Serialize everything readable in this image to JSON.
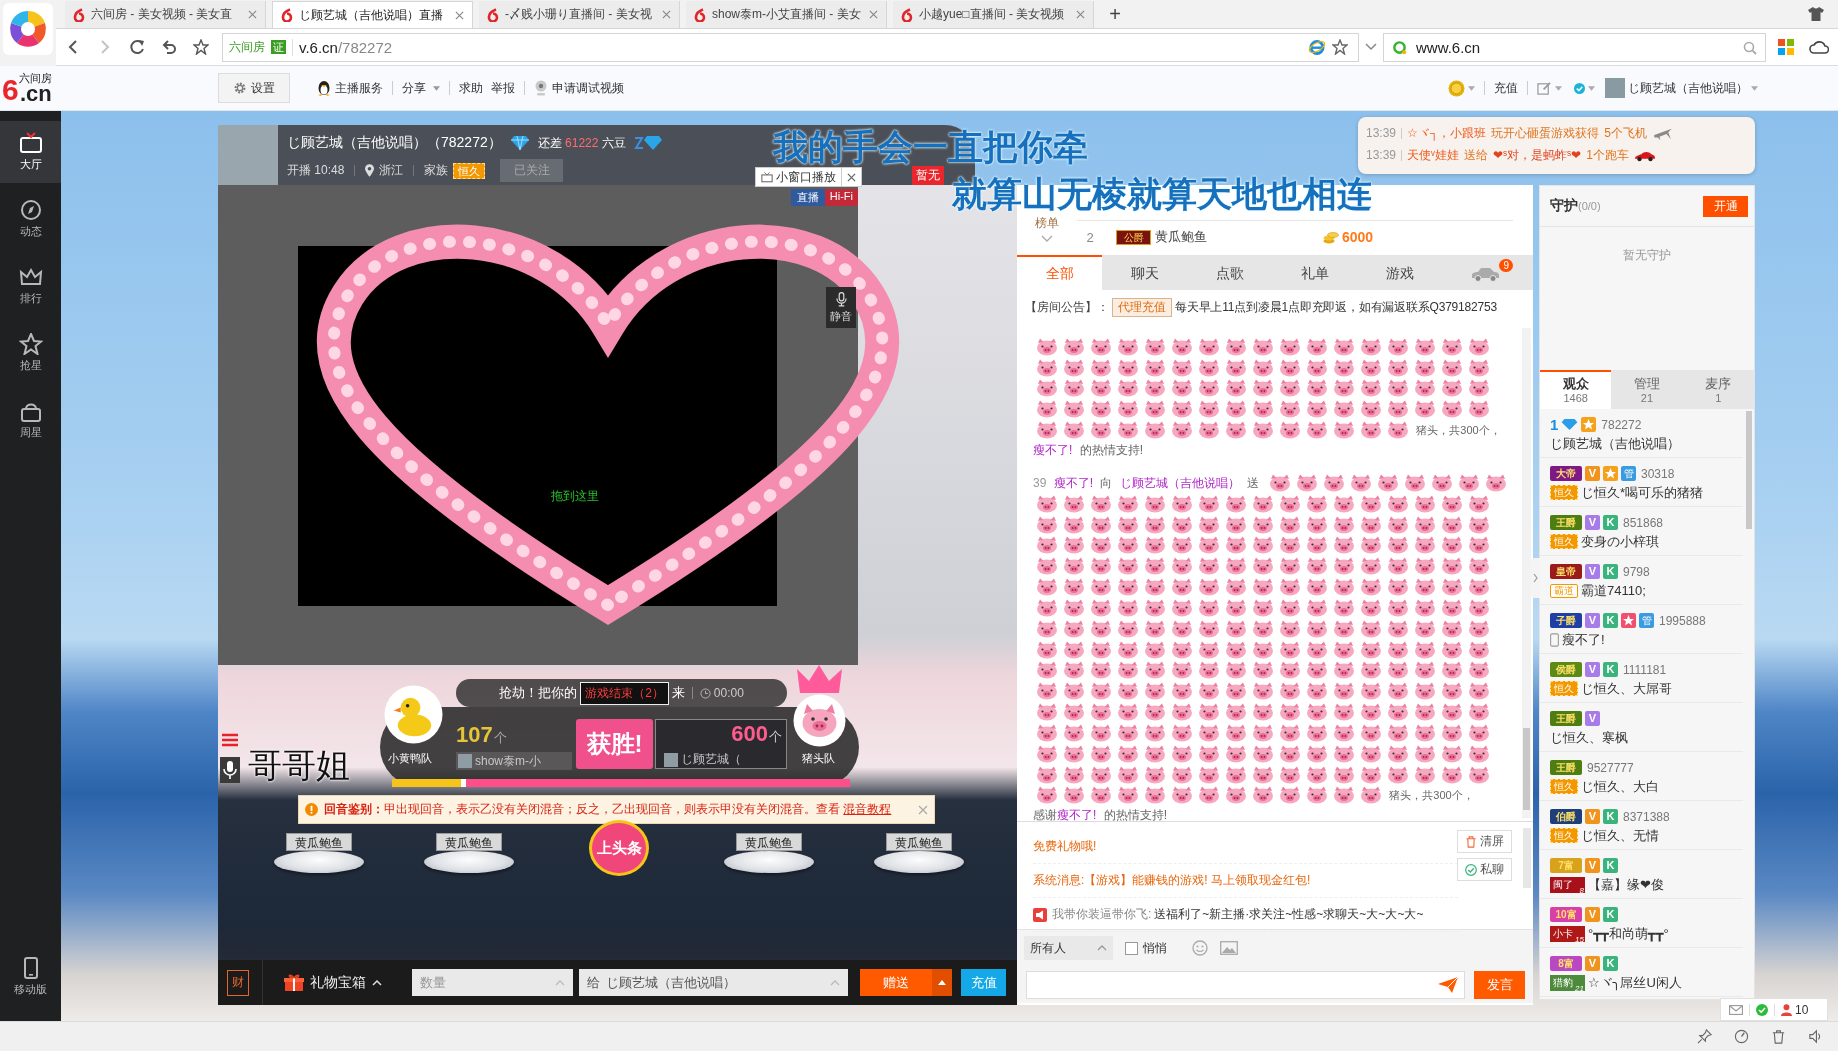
{
  "browser": {
    "tabs": [
      {
        "title": "六间房 - 美女视频 - 美女直",
        "selected": false
      },
      {
        "title": "じ顾艺城（吉他说唱）直播",
        "selected": true
      },
      {
        "title": "-〆贱小珊り直播间 - 美女视",
        "selected": false
      },
      {
        "title": "show泰m-小艾直播间 - 美女",
        "selected": false
      },
      {
        "title": "小越yue□直播间 - 美女视频",
        "selected": false
      }
    ],
    "new_tab": "+",
    "address": {
      "site": "六间房",
      "badge": "证",
      "host": "v.6.cn",
      "path": "/782272"
    },
    "search": {
      "value": "www.6.cn"
    }
  },
  "site_bar": {
    "logo_mark": "6",
    "logo_text": ".cn",
    "logo_caption": "六间房",
    "settings": "设置",
    "links": [
      {
        "label": "主播服务",
        "kind": "penguin"
      },
      {
        "label": "分享",
        "kind": "dropdown"
      },
      {
        "label": "求助",
        "kind": "plain"
      },
      {
        "label": "举报",
        "kind": "plain"
      },
      {
        "label": "申请调试视频",
        "kind": "webcam"
      }
    ],
    "recharge": "充值",
    "user": "じ顾艺城（吉他说唱）"
  },
  "sidebar": {
    "items": [
      {
        "kind": "tv",
        "label": "大厅",
        "selected": true
      },
      {
        "kind": "compass",
        "label": "动态",
        "selected": false
      },
      {
        "kind": "crown",
        "label": "排行",
        "selected": false
      },
      {
        "kind": "star",
        "label": "抢星",
        "selected": false
      },
      {
        "kind": "gift",
        "label": "周星",
        "selected": false
      }
    ],
    "mobile": "移动版"
  },
  "streamer": {
    "name": "じ顾艺城（吉他说唱）（782272）",
    "gap_label": "还差",
    "gap_value": "61222",
    "gap_unit": "六豆",
    "start": "开播 10:48",
    "location": "浙江",
    "family_label": "家族",
    "family_badge": "恒久",
    "follow": "已关注",
    "followed": true
  },
  "lyrics": [
    "我的手会一直把你牵",
    "就算山无棱就算天地也相连"
  ],
  "lyric_flag": "暂无",
  "ticker": [
    {
      "time": "13:39",
      "user": "☆ヾ┐，小跟班",
      "action": "玩开心砸蛋游戏获得",
      "item": "5个飞机",
      "kind": "plane"
    },
    {
      "time": "13:39",
      "user": "天使ᵛ娃娃",
      "action": "送给",
      "target": "❤ˢ对，是蚂蚱ˢ❤",
      "item": "1个跑车",
      "kind": "car"
    }
  ],
  "player": {
    "popout": "小窗口播放",
    "live_tag": "直播",
    "hifi_tag": "Hi-Fi",
    "mute": "静音",
    "drop_hint": "拖到这里",
    "caption": "哥哥姐"
  },
  "game": {
    "prompt": "抢劫！把你的",
    "status": "游戏结束（2）",
    "prompt_end": "来",
    "timer": "00:00",
    "win_label": "获胜!",
    "level": 0.15,
    "teams": [
      {
        "kind": "duck",
        "name": "小黄鸭队",
        "score": "107",
        "unit": "个",
        "member": "show泰m-小"
      },
      {
        "kind": "pig",
        "name": "猪头队",
        "score": "600",
        "unit": "个",
        "member": "じ顾艺城（"
      }
    ]
  },
  "notice": {
    "label": "回音鉴别：",
    "text": "甲出现回音，表示乙没有关闭混音；反之，乙出现回音，则表示甲没有关闭混音。查看",
    "link": "混音教程"
  },
  "gifts": [
    {
      "kind": "stand",
      "label": "黄瓜鲍鱼"
    },
    {
      "kind": "stand",
      "label": "黄瓜鲍鱼"
    },
    {
      "kind": "headline",
      "label": "上头条"
    },
    {
      "kind": "stand",
      "label": "黄瓜鲍鱼"
    },
    {
      "kind": "stand",
      "label": "黄瓜鲍鱼"
    }
  ],
  "gift_bar": {
    "wallet": "财",
    "gift_box": "礼物宝箱",
    "quantity_placeholder": "数量",
    "recipient_prefix": "给",
    "recipient": "じ顾艺城（吉他说唱）",
    "send": "赠送",
    "recharge": "充值"
  },
  "chat": {
    "rank": {
      "label": "榜单",
      "rows": [
        {
          "rank": "2",
          "title": "公爵",
          "name": "黄瓜鲍鱼",
          "amount": "6000"
        }
      ]
    },
    "tabs": [
      {
        "kind": "text",
        "label": "全部",
        "selected": true
      },
      {
        "kind": "text",
        "label": "聊天",
        "selected": false
      },
      {
        "kind": "text",
        "label": "点歌",
        "selected": false
      },
      {
        "kind": "text",
        "label": "礼单",
        "selected": false
      },
      {
        "kind": "text",
        "label": "游戏",
        "selected": false
      },
      {
        "kind": "car",
        "badge": "9",
        "selected": false
      }
    ],
    "announcement": {
      "label": "【房间公告】：",
      "tag": "代理充值",
      "text": "每天早上11点到凌晨1点即充即返，如有漏返联系Q379182753"
    },
    "messages": [
      {
        "kind": "gift",
        "tail": "猪头，共300个，",
        "thanks": {
          "user": "瘦不了!",
          "suffix": "的热情支持!"
        }
      },
      {
        "kind": "gift",
        "time": "39",
        "sender": "瘦不了!",
        "verb": "向",
        "recipient": "じ顾艺城（吉他说唱）",
        "action": "送",
        "tail": "猪头，共300个，",
        "thanks": {
          "prefix": "感谢",
          "user": "瘦不了!",
          "suffix": "的热情支持!"
        }
      }
    ],
    "notices": [
      {
        "kind": "hint",
        "text": "免费礼物哦!"
      },
      {
        "kind": "system",
        "label": "系统消息:",
        "text": "【游戏】能赚钱的游戏! 马上领取现金红包!"
      },
      {
        "kind": "broadcast",
        "sender": "我带你装逼带你飞:",
        "text": "送福利了~新主播·求关注~性感~求聊天~大~大~大~"
      }
    ],
    "clear": "清屏",
    "private": "私聊",
    "input": {
      "audience": "所有人",
      "whisper": "悄悄",
      "whisper_checked": false,
      "send": "发言"
    }
  },
  "guard": {
    "title": "守护",
    "count": "(0/0)",
    "open": "开通",
    "empty": "暂无守护"
  },
  "audience": {
    "tabs": [
      {
        "label": "观众",
        "count": "1468",
        "selected": true
      },
      {
        "label": "管理",
        "count": "21",
        "selected": false
      },
      {
        "label": "麦序",
        "count": "1",
        "selected": false
      }
    ],
    "users": [
      {
        "badges": [
          {
            "kind": "level",
            "text": "1"
          },
          {
            "kind": "star",
            "color": "#f5a11c"
          }
        ],
        "id": "782272",
        "name": "じ顾艺城（吉他说唱）"
      },
      {
        "badges": [
          {
            "kind": "title",
            "text": "大帝",
            "color": "#7d1a86"
          },
          {
            "kind": "letter",
            "text": "V",
            "color": "#f0941d"
          },
          {
            "kind": "star",
            "color": "#f5a11c"
          },
          {
            "kind": "admin",
            "text": "管"
          }
        ],
        "id": "30318",
        "tag": {
          "kind": "family",
          "text": "恒久"
        },
        "name": "じ恒久*喝可乐的猪猪"
      },
      {
        "badges": [
          {
            "kind": "title",
            "text": "王爵",
            "color": "#4e7d12"
          },
          {
            "kind": "letter",
            "text": "V",
            "color": "#a77be8"
          },
          {
            "kind": "letter",
            "text": "K",
            "color": "#3ab37c"
          }
        ],
        "id": "851868",
        "tag": {
          "kind": "family",
          "text": "恒久"
        },
        "name": "变身の小梓琪"
      },
      {
        "badges": [
          {
            "kind": "title",
            "text": "皇帝",
            "color": "#9b1a1a"
          },
          {
            "kind": "letter",
            "text": "V",
            "color": "#a77be8"
          },
          {
            "kind": "letter",
            "text": "K",
            "color": "#3ab37c"
          }
        ],
        "id": "9798",
        "tag": {
          "kind": "outline",
          "text": "霸道"
        },
        "name": "霸道74110;"
      },
      {
        "badges": [
          {
            "kind": "title",
            "text": "子爵",
            "color": "#1f3fa8"
          },
          {
            "kind": "letter",
            "text": "V",
            "color": "#a77be8"
          },
          {
            "kind": "letter",
            "text": "K",
            "color": "#3ab37c"
          },
          {
            "kind": "star",
            "color": "#f0506e"
          },
          {
            "kind": "admin",
            "text": "管"
          }
        ],
        "id": "1995888",
        "mobile": true,
        "name": "瘦不了!"
      },
      {
        "badges": [
          {
            "kind": "title",
            "text": "侯爵",
            "color": "#5b8a16"
          },
          {
            "kind": "letter",
            "text": "V",
            "color": "#a77be8"
          },
          {
            "kind": "letter",
            "text": "K",
            "color": "#3ab37c"
          }
        ],
        "id": "1111181",
        "tag": {
          "kind": "family",
          "text": "恒久"
        },
        "name": "じ恒久、大屌哥"
      },
      {
        "badges": [
          {
            "kind": "title",
            "text": "王爵",
            "color": "#4e7d12"
          },
          {
            "kind": "letter",
            "text": "V",
            "color": "#a77be8"
          }
        ],
        "name": "じ恒久、寒枫"
      },
      {
        "badges": [
          {
            "kind": "title",
            "text": "王爵",
            "color": "#4e7d12"
          }
        ],
        "id": "9527777",
        "tag": {
          "kind": "family",
          "text": "恒久"
        },
        "name": "じ恒久、大白"
      },
      {
        "badges": [
          {
            "kind": "title",
            "text": "伯爵",
            "color": "#1e3f7a"
          },
          {
            "kind": "letter",
            "text": "V",
            "color": "#f0941d"
          },
          {
            "kind": "letter",
            "text": "K",
            "color": "#3ab37c"
          }
        ],
        "id": "8371388",
        "tag": {
          "kind": "family",
          "text": "恒久"
        },
        "name": "じ恒久、无情"
      },
      {
        "badges": [
          {
            "kind": "title",
            "text": "7富",
            "color": "#d9a21c"
          },
          {
            "kind": "letter",
            "text": "V",
            "color": "#f0941d"
          },
          {
            "kind": "letter",
            "text": "K",
            "color": "#3ab37c"
          }
        ],
        "tag": {
          "kind": "club",
          "text": "闽了",
          "level": "8",
          "color": "#a8101a"
        },
        "name": "【嘉】缘❤俊"
      },
      {
        "badges": [
          {
            "kind": "title",
            "text": "10富",
            "color": "#d83fa8"
          },
          {
            "kind": "letter",
            "text": "V",
            "color": "#f0941d"
          },
          {
            "kind": "letter",
            "text": "K",
            "color": "#3ab37c"
          }
        ],
        "tag": {
          "kind": "club",
          "text": "小卡",
          "level": "15",
          "color": "#b01818"
        },
        "name": "°┳┳和尚萌┳┳°"
      },
      {
        "badges": [
          {
            "kind": "title",
            "text": "8富",
            "color": "#b948c2"
          },
          {
            "kind": "letter",
            "text": "V",
            "color": "#f0941d"
          },
          {
            "kind": "letter",
            "text": "K",
            "color": "#3ab37c"
          }
        ],
        "tag": {
          "kind": "club",
          "text": "猎豹",
          "level": "21",
          "color": "#4d8a3c"
        },
        "name": "☆ヾ╮屌丝U闲人"
      }
    ]
  },
  "footer_widget": {
    "online": "10"
  }
}
